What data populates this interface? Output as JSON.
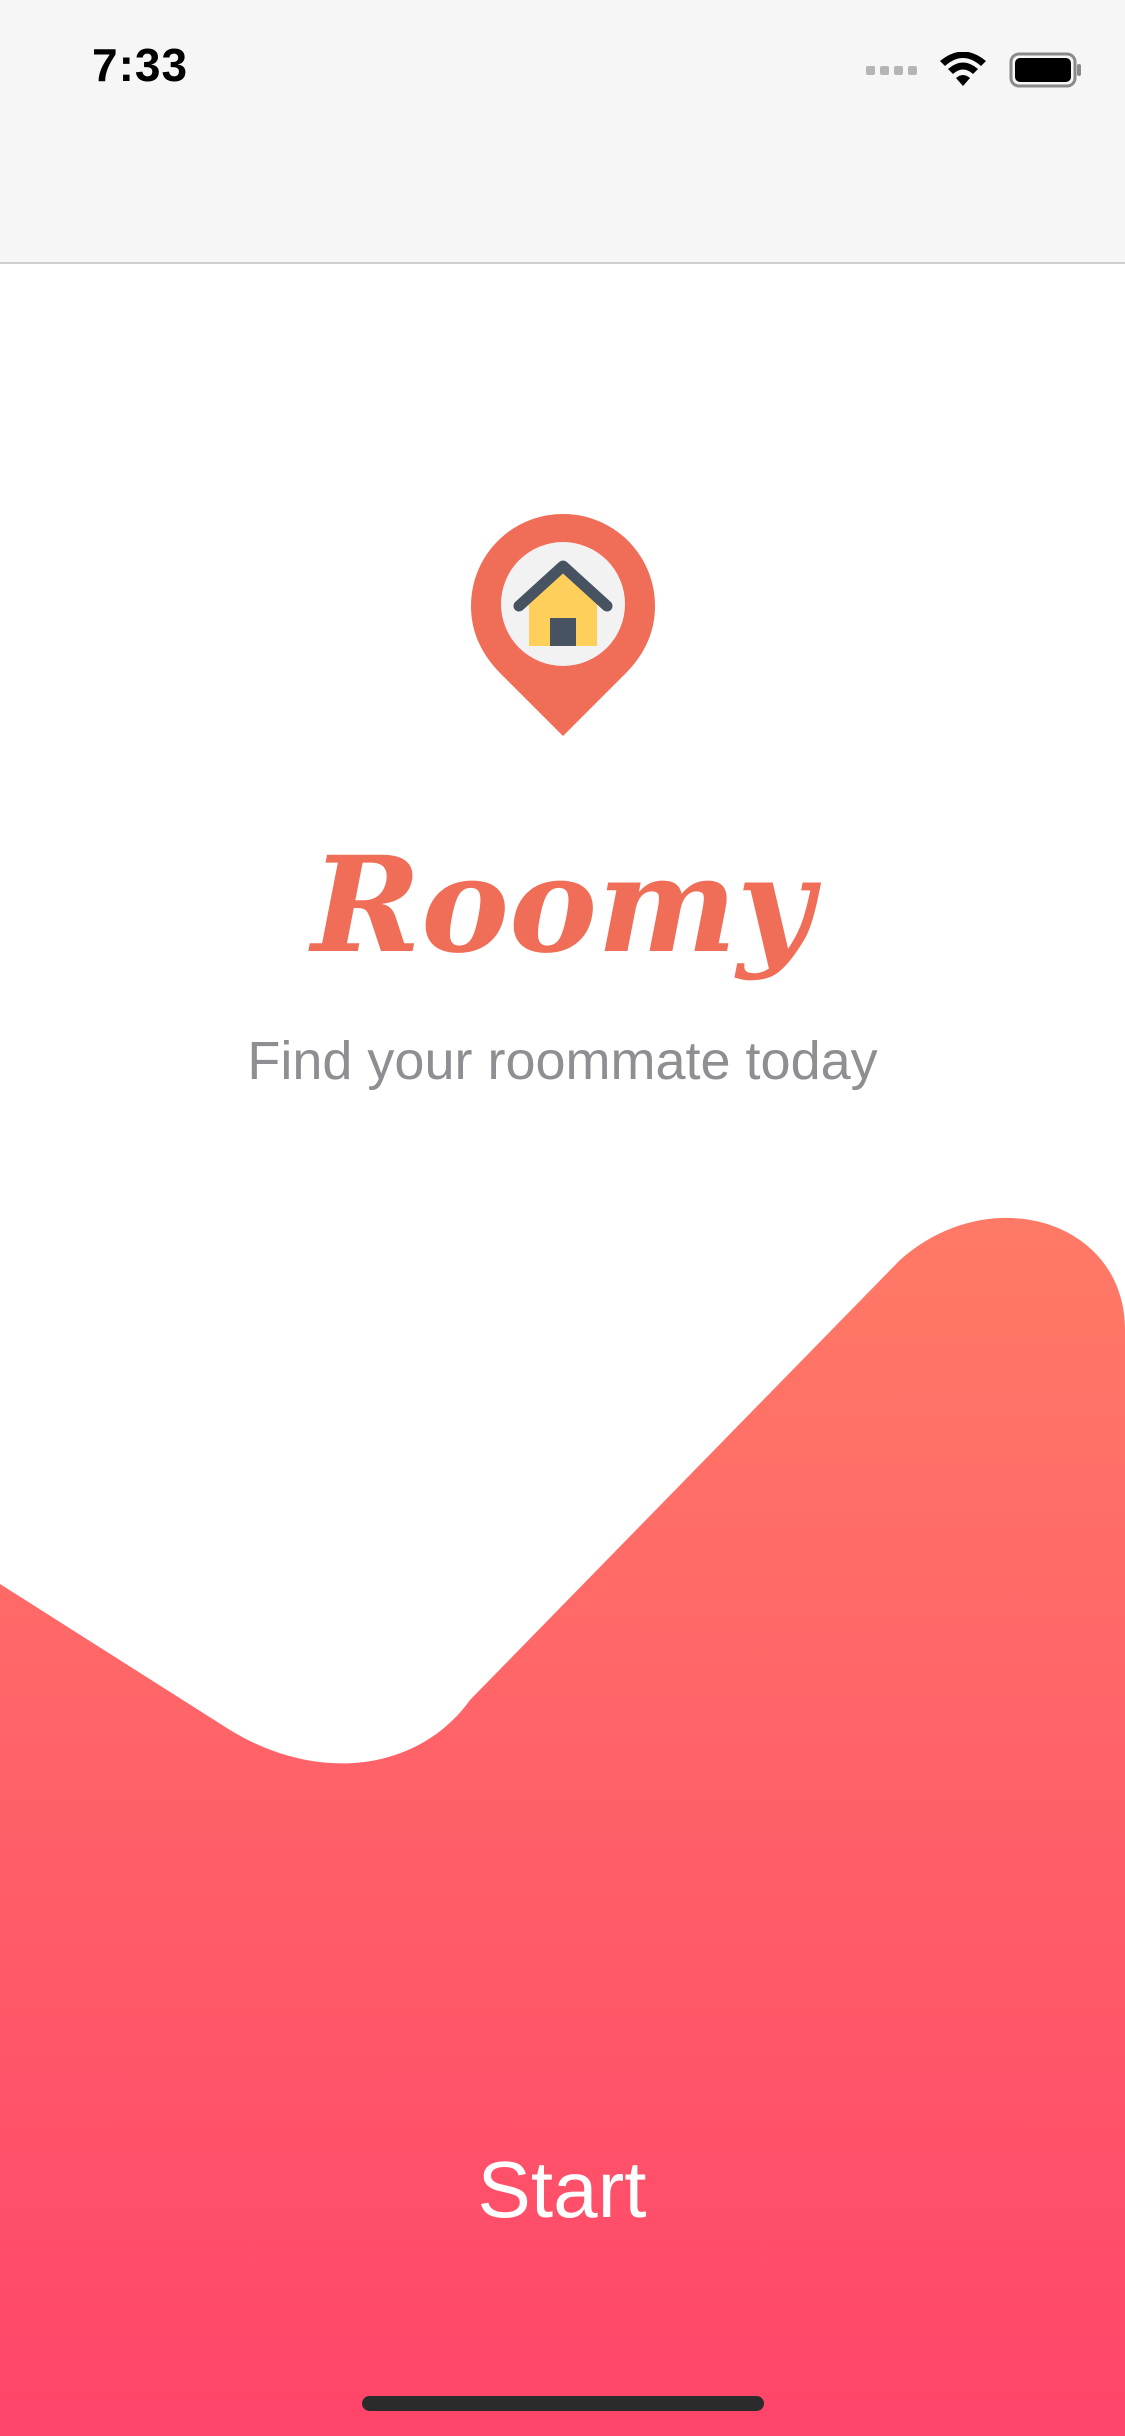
{
  "status_bar": {
    "time": "7:33",
    "icons": [
      "signal-icon",
      "wifi-icon",
      "battery-icon"
    ]
  },
  "app": {
    "title": "Roomy",
    "tagline": "Find your roommate today",
    "logo_icon": "house-location-pin-icon"
  },
  "actions": {
    "start_label": "Start"
  },
  "colors": {
    "brand": "#f06e58",
    "gradient_top": "#ff7a66",
    "gradient_bottom": "#ff456a",
    "tagline": "#8e8e93"
  }
}
